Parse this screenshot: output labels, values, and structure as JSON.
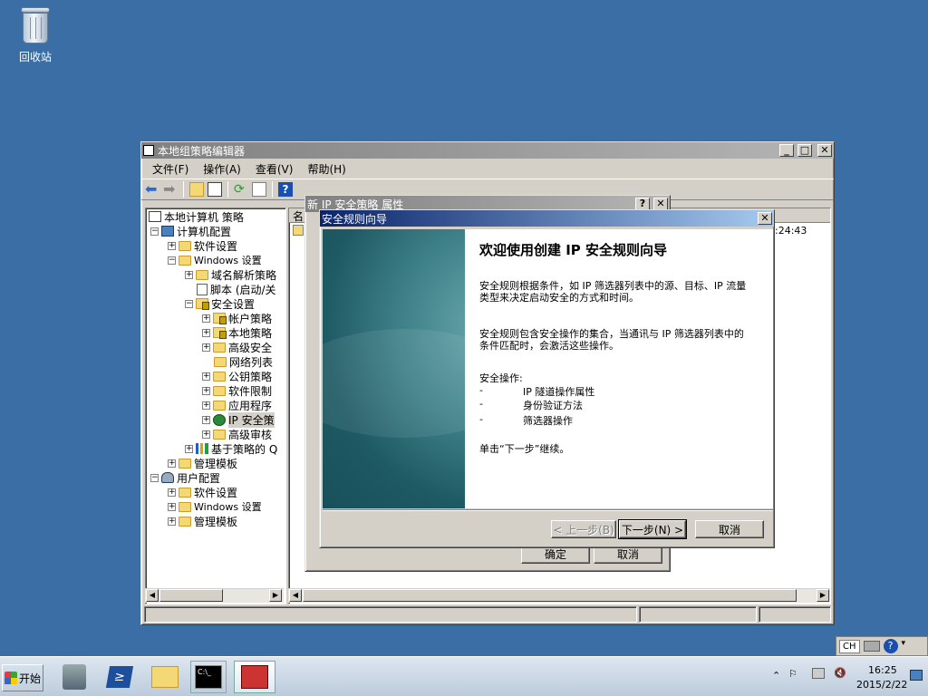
{
  "desktop": {
    "recycle_bin": "回收站"
  },
  "main_window": {
    "title": "本地组策略编辑器",
    "menu": [
      "文件(F)",
      "操作(A)",
      "查看(V)",
      "帮助(H)"
    ],
    "tree": [
      {
        "label": "本地计算机 策略",
        "icon": "policy-icon"
      },
      {
        "label": "计算机配置",
        "icon": "computer-icon",
        "expander": "minus"
      },
      {
        "label": "软件设置",
        "icon": "folder-icon",
        "expander": "plus"
      },
      {
        "label": "Windows 设置",
        "icon": "folder-icon",
        "expander": "minus"
      },
      {
        "label": "域名解析策略",
        "icon": "folder-icon",
        "expander": "plus"
      },
      {
        "label": "脚本 (启动/关",
        "icon": "script-icon"
      },
      {
        "label": "安全设置",
        "icon": "security-icon",
        "expander": "minus"
      },
      {
        "label": "帐户策略",
        "icon": "lock-folder-icon",
        "expander": "plus"
      },
      {
        "label": "本地策略",
        "icon": "lock-folder-icon",
        "expander": "plus"
      },
      {
        "label": "高级安全",
        "icon": "folder-icon",
        "expander": "plus"
      },
      {
        "label": "网络列表",
        "icon": "folder-icon"
      },
      {
        "label": "公钥策略",
        "icon": "folder-icon",
        "expander": "plus"
      },
      {
        "label": "软件限制",
        "icon": "folder-icon",
        "expander": "plus"
      },
      {
        "label": "应用程序",
        "icon": "folder-icon",
        "expander": "plus"
      },
      {
        "label": "IP 安全策",
        "icon": "ipsec-icon",
        "expander": "plus"
      },
      {
        "label": "高级审核",
        "icon": "folder-icon",
        "expander": "plus"
      },
      {
        "label": "基于策略的 Q",
        "icon": "chart-icon",
        "expander": "plus"
      },
      {
        "label": "管理模板",
        "icon": "folder-icon",
        "expander": "plus"
      },
      {
        "label": "用户配置",
        "icon": "user-icon",
        "expander": "minus"
      },
      {
        "label": "软件设置",
        "icon": "folder-icon",
        "expander": "plus"
      },
      {
        "label": "Windows 设置",
        "icon": "folder-icon",
        "expander": "plus"
      },
      {
        "label": "管理模板",
        "icon": "folder-icon",
        "expander": "plus"
      }
    ],
    "list_header": "名",
    "list_time": ":24:43"
  },
  "props_dialog": {
    "title": "新 IP 安全策略 属性",
    "ok": "确定",
    "cancel": "取消"
  },
  "wizard": {
    "title": "安全规则向导",
    "heading": "欢迎使用创建 IP 安全规则向导",
    "para1": "安全规则根据条件，如 IP 筛选器列表中的源、目标、IP 流量类型来决定启动安全的方式和时间。",
    "para2": "安全规则包含安全操作的集合，当通讯与 IP 筛选器列表中的条件匹配时，会激活这些操作。",
    "ops_label": "安全操作:",
    "ops": [
      "IP 隧道操作属性",
      "身份验证方法",
      "筛选器操作"
    ],
    "ops_dash": "-",
    "next_hint": "单击“下一步”继续。",
    "back_btn": "< 上一步(B)",
    "next_btn": "下一步(N) >",
    "cancel_btn": "取消"
  },
  "taskbar": {
    "start": "开始",
    "lang": "CH",
    "time": "16:25",
    "date": "2015/2/22"
  }
}
